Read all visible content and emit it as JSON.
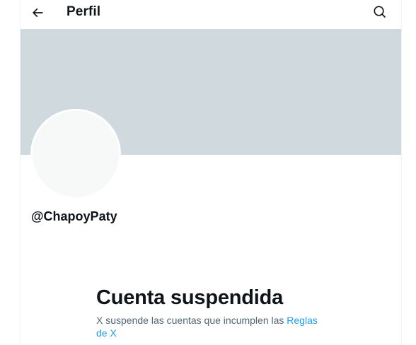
{
  "header": {
    "title": "Perfil",
    "back_icon": "arrow-left-icon",
    "search_icon": "search-icon"
  },
  "profile": {
    "handle": "@ChapoyPaty"
  },
  "suspension": {
    "title": "Cuenta suspendida",
    "description": "X suspende las cuentas que incumplen las ",
    "rules_link": "Reglas de X"
  },
  "colors": {
    "banner": "#cfd9de",
    "avatar": "#f7f9f9",
    "link": "#1d9bf0",
    "text": "#0f1419",
    "secondary_text": "#536471"
  }
}
